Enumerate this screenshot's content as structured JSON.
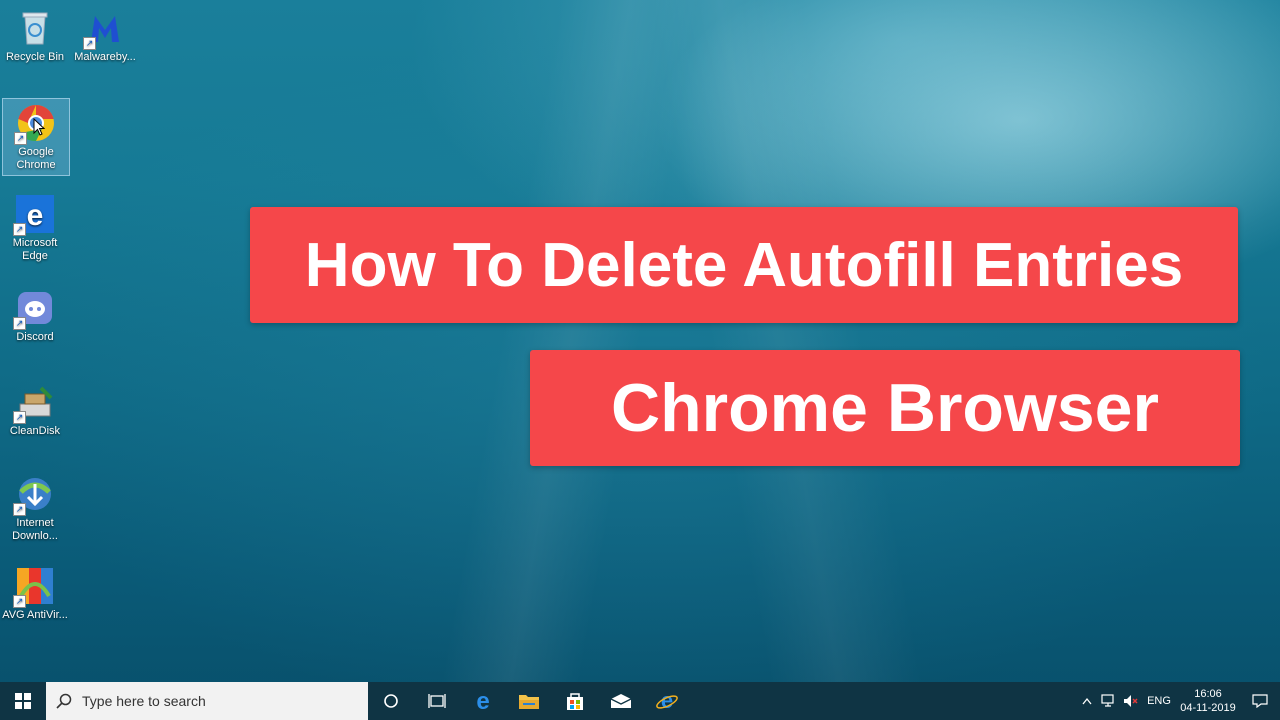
{
  "desktop": {
    "icons": [
      {
        "label": "Recycle Bin",
        "icon": "recycle-bin-icon"
      },
      {
        "label": "Malwareby...",
        "icon": "malwarebytes-icon"
      },
      {
        "label": "Google Chrome",
        "icon": "chrome-icon"
      },
      {
        "label": "Microsoft Edge",
        "icon": "edge-icon"
      },
      {
        "label": "Discord",
        "icon": "discord-icon"
      },
      {
        "label": "CleanDisk",
        "icon": "cleandisk-icon"
      },
      {
        "label": "Internet Downlo...",
        "icon": "idm-icon"
      },
      {
        "label": "AVG AntiVir...",
        "icon": "avg-icon"
      }
    ],
    "banners": {
      "line1": "How To Delete Autofill Entries",
      "line2": "Chrome Browser"
    },
    "banner_color": "#f5474a"
  },
  "taskbar": {
    "search_placeholder": "Type here to search",
    "pinned": [
      "cortana-icon",
      "task-view-icon",
      "edge-icon",
      "file-explorer-icon",
      "store-icon",
      "mail-icon",
      "internet-explorer-icon"
    ],
    "tray": {
      "language": "ENG",
      "time": "16:06",
      "date": "04-11-2019"
    }
  }
}
